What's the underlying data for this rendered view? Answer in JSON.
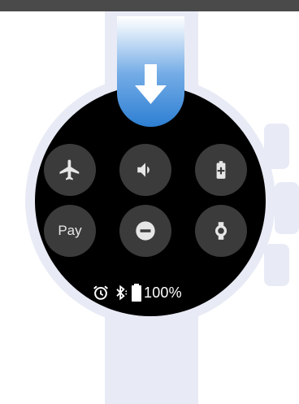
{
  "screen": {
    "description_icons": {
      "swipe_arrow": "arrow-down-icon",
      "tiles": [
        "airplane-icon",
        "volume-icon",
        "battery-saver-icon",
        "pay-icon",
        "do-not-disturb-icon",
        "watch-icon"
      ],
      "status": [
        "alarm-icon",
        "bluetooth-icon",
        "battery-icon"
      ]
    },
    "tiles": {
      "pay_label": "Pay"
    },
    "status": {
      "battery_text": "100%"
    }
  },
  "colors": {
    "accent": "#2d7fd3",
    "tile_bg": "#3b3b3b",
    "strap": "#e8ebf5"
  }
}
